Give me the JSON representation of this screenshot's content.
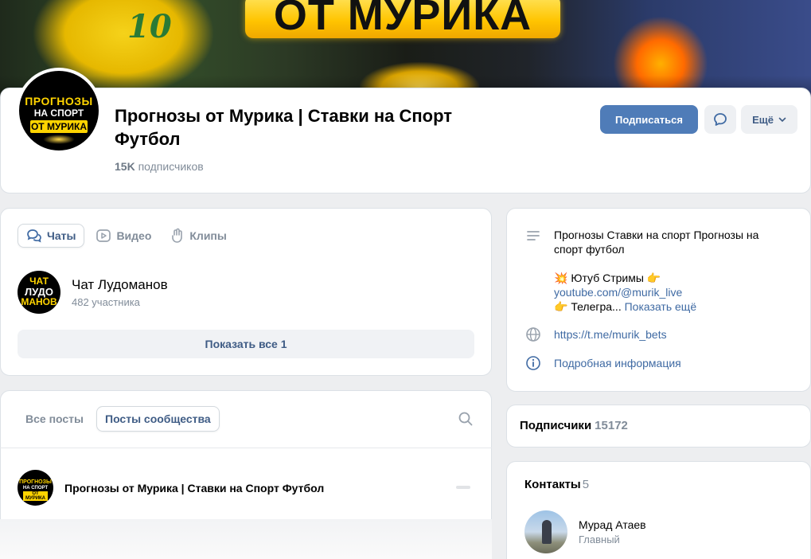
{
  "cover": {
    "banner_text": "ОТ МУРИКА",
    "jersey_number": "10"
  },
  "group": {
    "avatar_line1": "ПРОГНОЗЫ",
    "avatar_line2": "НА СПОРТ",
    "avatar_line3": "ОТ МУРИКА",
    "title": "Прогнозы от Мурика | Ставки на Спорт Футбол",
    "subscribers_count": "15K",
    "subscribers_label": "подписчиков"
  },
  "actions": {
    "subscribe_label": "Подписаться",
    "more_label": "Ещё"
  },
  "tabs": [
    {
      "label": "Чаты",
      "icon": "chat-bubbles-icon",
      "active": true
    },
    {
      "label": "Видео",
      "icon": "video-play-icon",
      "active": false
    },
    {
      "label": "Клипы",
      "icon": "clip-hand-icon",
      "active": false
    }
  ],
  "chat": {
    "avatar_l1": "ЧАТ",
    "avatar_l2": "ЛУДО",
    "avatar_l3": "МАНОВ",
    "name": "Чат Лудоманов",
    "members": "482 участника",
    "show_all": "Показать все 1"
  },
  "posts": {
    "tab_all": "Все посты",
    "tab_community": "Посты сообщества",
    "author": "Прогнозы от Мурика | Ставки на Спорт Футбол"
  },
  "info": {
    "description_line": "Прогнозы Ставки на спорт Прогнозы на спорт футбол",
    "youtube_prefix": "💥 Ютуб Стримы 👉",
    "youtube_link": "youtube.com/@murik_live",
    "telegram_prefix": "👉 Телегра...",
    "show_more": "Показать ещё",
    "website": "https://t.me/murik_bets",
    "details": "Подробная информация"
  },
  "subscribers": {
    "label": "Подписчики",
    "count": "15172"
  },
  "contacts": {
    "label": "Контакты",
    "count": "5",
    "first_name": "Мурад Атаев",
    "first_role": "Главный"
  }
}
